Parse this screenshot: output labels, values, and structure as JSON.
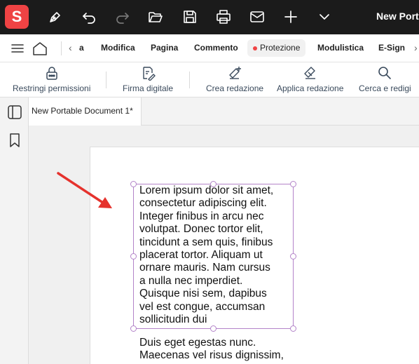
{
  "app": {
    "logo_letter": "S",
    "window_title": "New Porta"
  },
  "titlebar_icons": [
    "pen-icon",
    "undo-icon",
    "redo-icon",
    "open-folder-icon",
    "save-icon",
    "print-icon",
    "mail-icon",
    "new-icon",
    "chevron-down-icon"
  ],
  "menu": {
    "prev_partial": "a",
    "tabs": [
      "Modifica",
      "Pagina",
      "Commento",
      "Protezione",
      "Modulistica",
      "E-Sign"
    ],
    "active_tab": "Protezione"
  },
  "ribbon": {
    "items": [
      {
        "label": "Restringi permissioni",
        "icon": "lock-icon"
      },
      {
        "label": "Firma digitale",
        "icon": "digital-signature-icon"
      },
      {
        "label": "Crea redazione",
        "icon": "create-redaction-icon"
      },
      {
        "label": "Applica redazione",
        "icon": "apply-redaction-icon"
      },
      {
        "label": "Cerca e redigi",
        "icon": "search-redact-icon"
      }
    ]
  },
  "document_tab": {
    "title": "New Portable Document 1*"
  },
  "content": {
    "para1_lines": [
      "Lorem ipsum dolor sit amet,",
      "consectetur adipiscing elit.",
      "Integer finibus in arcu nec",
      "volutpat. Donec tortor elit,",
      "tincidunt a sem quis, finibus",
      "placerat tortor. Aliquam ut",
      "ornare mauris. Nam cursus",
      "a nulla nec imperdiet.",
      "Quisque nisi sem, dapibus",
      "vel est congue, accumsan",
      "sollicitudin dui"
    ],
    "para2_lines": [
      "Duis eget egestas nunc.",
      "Maecenas vel risus dignissim,"
    ]
  },
  "colors": {
    "brand": "#ef4344",
    "selection": "#b383c9",
    "arrow": "#e5322d"
  }
}
